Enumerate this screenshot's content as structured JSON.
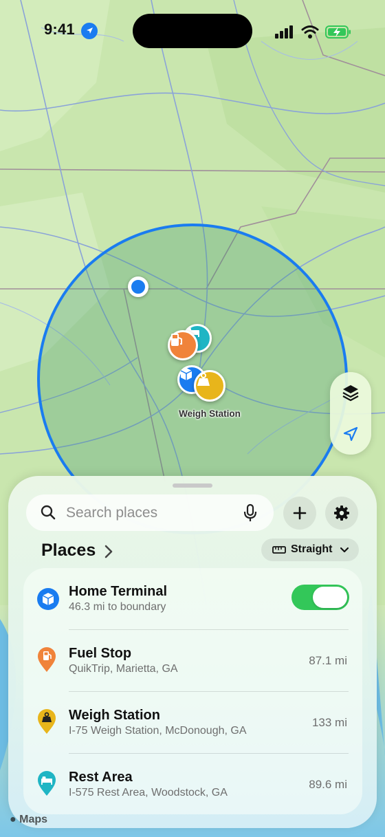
{
  "status_bar": {
    "time": "9:41",
    "location_icon": "location-arrow-icon",
    "signal_icon": "cellular-signal-icon",
    "wifi_icon": "wifi-icon",
    "battery_icon": "battery-charging-icon"
  },
  "map": {
    "geofence_color": "#1a7cf0",
    "label_weigh_station": "Weigh Station",
    "markers": [
      {
        "name": "rest-area",
        "icon": "bed-icon",
        "color": "#1fb5c4"
      },
      {
        "name": "fuel-stop",
        "icon": "fuel-pump-icon",
        "color": "#f0833a"
      },
      {
        "name": "home-terminal",
        "icon": "package-icon",
        "color": "#1a7cf0"
      },
      {
        "name": "weigh-station",
        "icon": "weight-icon",
        "color": "#e8b51b"
      }
    ],
    "legal_label": "Maps"
  },
  "map_controls": {
    "layers_icon": "layers-icon",
    "locate_icon": "location-arrow-icon"
  },
  "search": {
    "placeholder": "Search places",
    "value": ""
  },
  "places": {
    "title": "Places",
    "mode_label": "Straight",
    "items": [
      {
        "title": "Home Terminal",
        "subtitle": "46.3 mi to boundary",
        "distance": "",
        "icon": "package-icon",
        "color": "#1a7cf0",
        "toggle_on": true
      },
      {
        "title": "Fuel Stop",
        "subtitle": "QuikTrip, Marietta, GA",
        "distance": "87.1 mi",
        "icon": "fuel-pump-icon",
        "color": "#f0833a"
      },
      {
        "title": "Weigh Station",
        "subtitle": "I-75 Weigh Station, McDonough, GA",
        "distance": "133 mi",
        "icon": "weight-icon",
        "color": "#e8b51b"
      },
      {
        "title": "Rest Area",
        "subtitle": "I-575 Rest Area, Woodstock, GA",
        "distance": "89.6 mi",
        "icon": "bed-icon",
        "color": "#1fb5c4"
      }
    ]
  }
}
